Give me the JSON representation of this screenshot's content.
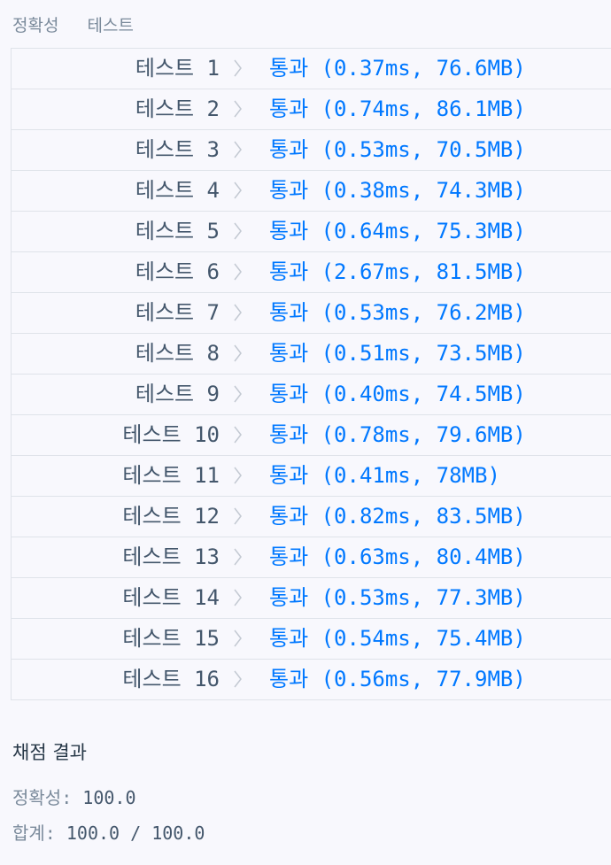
{
  "tabs": [
    "정확성",
    "테스트"
  ],
  "tests": [
    {
      "label": "테스트 1",
      "result": "통과 (0.37ms, 76.6MB)"
    },
    {
      "label": "테스트 2",
      "result": "통과 (0.74ms, 86.1MB)"
    },
    {
      "label": "테스트 3",
      "result": "통과 (0.53ms, 70.5MB)"
    },
    {
      "label": "테스트 4",
      "result": "통과 (0.38ms, 74.3MB)"
    },
    {
      "label": "테스트 5",
      "result": "통과 (0.64ms, 75.3MB)"
    },
    {
      "label": "테스트 6",
      "result": "통과 (2.67ms, 81.5MB)"
    },
    {
      "label": "테스트 7",
      "result": "통과 (0.53ms, 76.2MB)"
    },
    {
      "label": "테스트 8",
      "result": "통과 (0.51ms, 73.5MB)"
    },
    {
      "label": "테스트 9",
      "result": "통과 (0.40ms, 74.5MB)"
    },
    {
      "label": "테스트 10",
      "result": "통과 (0.78ms, 79.6MB)"
    },
    {
      "label": "테스트 11",
      "result": "통과 (0.41ms, 78MB)"
    },
    {
      "label": "테스트 12",
      "result": "통과 (0.82ms, 83.5MB)"
    },
    {
      "label": "테스트 13",
      "result": "통과 (0.63ms, 80.4MB)"
    },
    {
      "label": "테스트 14",
      "result": "통과 (0.53ms, 77.3MB)"
    },
    {
      "label": "테스트 15",
      "result": "통과 (0.54ms, 75.4MB)"
    },
    {
      "label": "테스트 16",
      "result": "통과 (0.56ms, 77.9MB)"
    }
  ],
  "summary": {
    "title": "채점 결과",
    "accuracy_label": "정확성:",
    "accuracy_value": "100.0",
    "total_label": "합계:",
    "total_value": "100.0 / 100.0"
  },
  "colors": {
    "pass": "#0078ff",
    "text": "#44576c",
    "muted": "#7a8a9b",
    "border": "#dfe3ea"
  }
}
